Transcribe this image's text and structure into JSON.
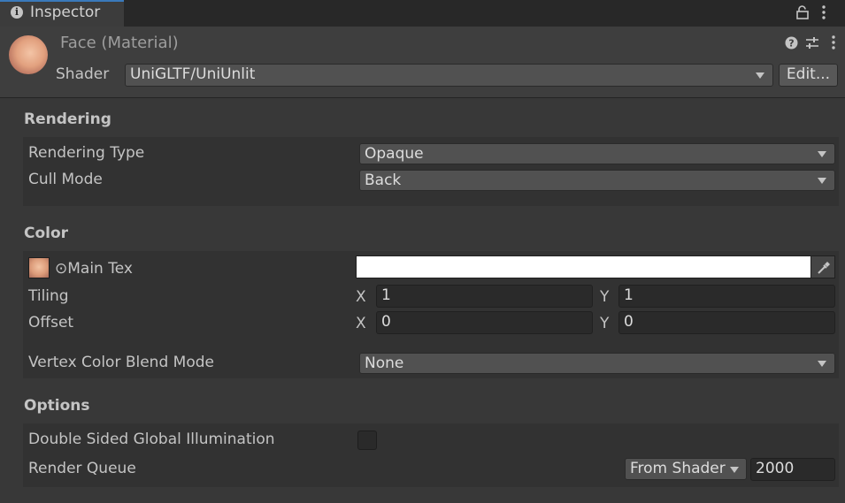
{
  "tab": {
    "title": "Inspector",
    "info_icon": "info-icon",
    "lock_icon": "lock-icon",
    "menu_icon": "kebab-menu-icon"
  },
  "header": {
    "material_name": "Face (Material)",
    "shader_label": "Shader",
    "shader_value": "UniGLTF/UniUnlit",
    "edit_label": "Edit...",
    "icons": [
      "help-icon",
      "presets-icon",
      "kebab-menu-icon"
    ]
  },
  "rendering": {
    "title": "Rendering",
    "rendering_type_label": "Rendering Type",
    "rendering_type_value": "Opaque",
    "cull_mode_label": "Cull Mode",
    "cull_mode_value": "Back"
  },
  "color": {
    "title": "Color",
    "main_tex_label": "⊙Main Tex",
    "main_tex_color": "#ffffff",
    "tiling_label": "Tiling",
    "tiling_x_label": "X",
    "tiling_x": "1",
    "tiling_y_label": "Y",
    "tiling_y": "1",
    "offset_label": "Offset",
    "offset_x_label": "X",
    "offset_x": "0",
    "offset_y_label": "Y",
    "offset_y": "0",
    "vertex_blend_label": "Vertex Color Blend Mode",
    "vertex_blend_value": "None"
  },
  "options": {
    "title": "Options",
    "double_sided_gi_label": "Double Sided Global Illumination",
    "double_sided_gi_checked": false,
    "render_queue_label": "Render Queue",
    "render_queue_mode": "From Shader",
    "render_queue_value": "2000"
  },
  "colors": {
    "background": "#383838",
    "panel": "#323232",
    "tab_accent": "#3a79bb",
    "text": "#c4c4c4"
  }
}
